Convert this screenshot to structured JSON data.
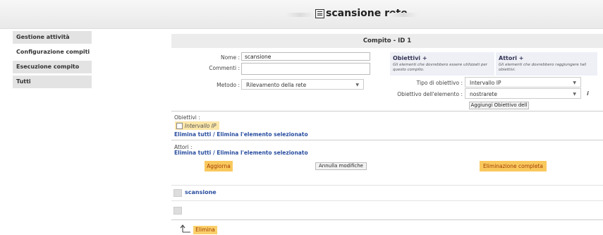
{
  "header": {
    "title": "scansione rete",
    "icon": "document-list-icon"
  },
  "sidebar": {
    "items": [
      {
        "label": "Gestione attività",
        "active": false
      },
      {
        "label": "Configurazione compiti",
        "active": true
      },
      {
        "label": "Esecuzione compito",
        "active": false
      },
      {
        "label": "Tutti",
        "active": false
      }
    ]
  },
  "panel": {
    "title": "Compito - ID 1",
    "name_label": "Nome :",
    "name_value": "scansione",
    "comments_label": "Commenti :",
    "comments_value": "",
    "method_label": "Metodo :",
    "method_value": "Rilevamento della rete",
    "objectives_box": {
      "title": "Obiettivi +",
      "desc": "Gli elementi che dovrebbero essere utilizzati per questo compito."
    },
    "actors_box": {
      "title": "Attori +",
      "desc": "Gli elementi che dovrebbero raggiungere tali obiettivi."
    },
    "objective_type_label": "Tipo di obiettivo :",
    "objective_type_value": "Intervallo IP",
    "objective_element_label": "Obiettivo dell'elemento :",
    "objective_element_value": "nostrarete",
    "info_mark": "i",
    "add_objective_button": "Aggiungi Obiettivo dell"
  },
  "objectives": {
    "label": "Obiettivi :",
    "tag": "Intervallo IP",
    "delete_all": "Elimina tutti",
    "separator": " / ",
    "delete_selected": "Elimina l'elemento selezionato"
  },
  "actors": {
    "label": "Attori :",
    "delete_all": "Elimina tutti",
    "separator": " / ",
    "delete_selected": "Elimina l'elemento selezionato"
  },
  "actions": {
    "update": "Aggiorna",
    "cancel": "Annulla modifiche",
    "full_delete": "Eliminazione completa"
  },
  "list": {
    "rows": [
      {
        "label": "scansione"
      },
      {
        "label": ""
      }
    ]
  },
  "footer": {
    "delete": "Elimina"
  },
  "colors": {
    "accent": "#f9c95e",
    "link": "#2a4fa0",
    "header_bg": "#ececec"
  }
}
